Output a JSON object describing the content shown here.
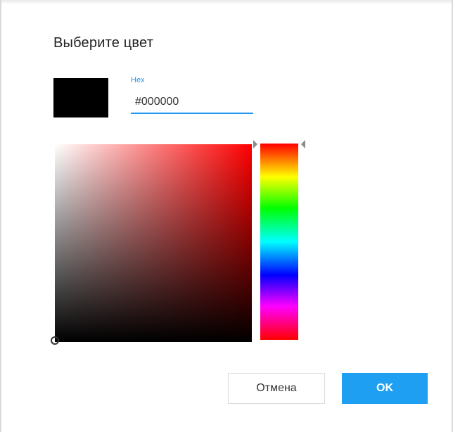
{
  "dialog": {
    "title": "Выберите цвет",
    "hex": {
      "label": "Hex",
      "value": "#000000"
    },
    "preview_color": "#000000",
    "hue_color": "#ff0000",
    "accent_color": "#1e9ff2",
    "buttons": {
      "cancel_label": "Отмена",
      "ok_label": "OK"
    }
  }
}
